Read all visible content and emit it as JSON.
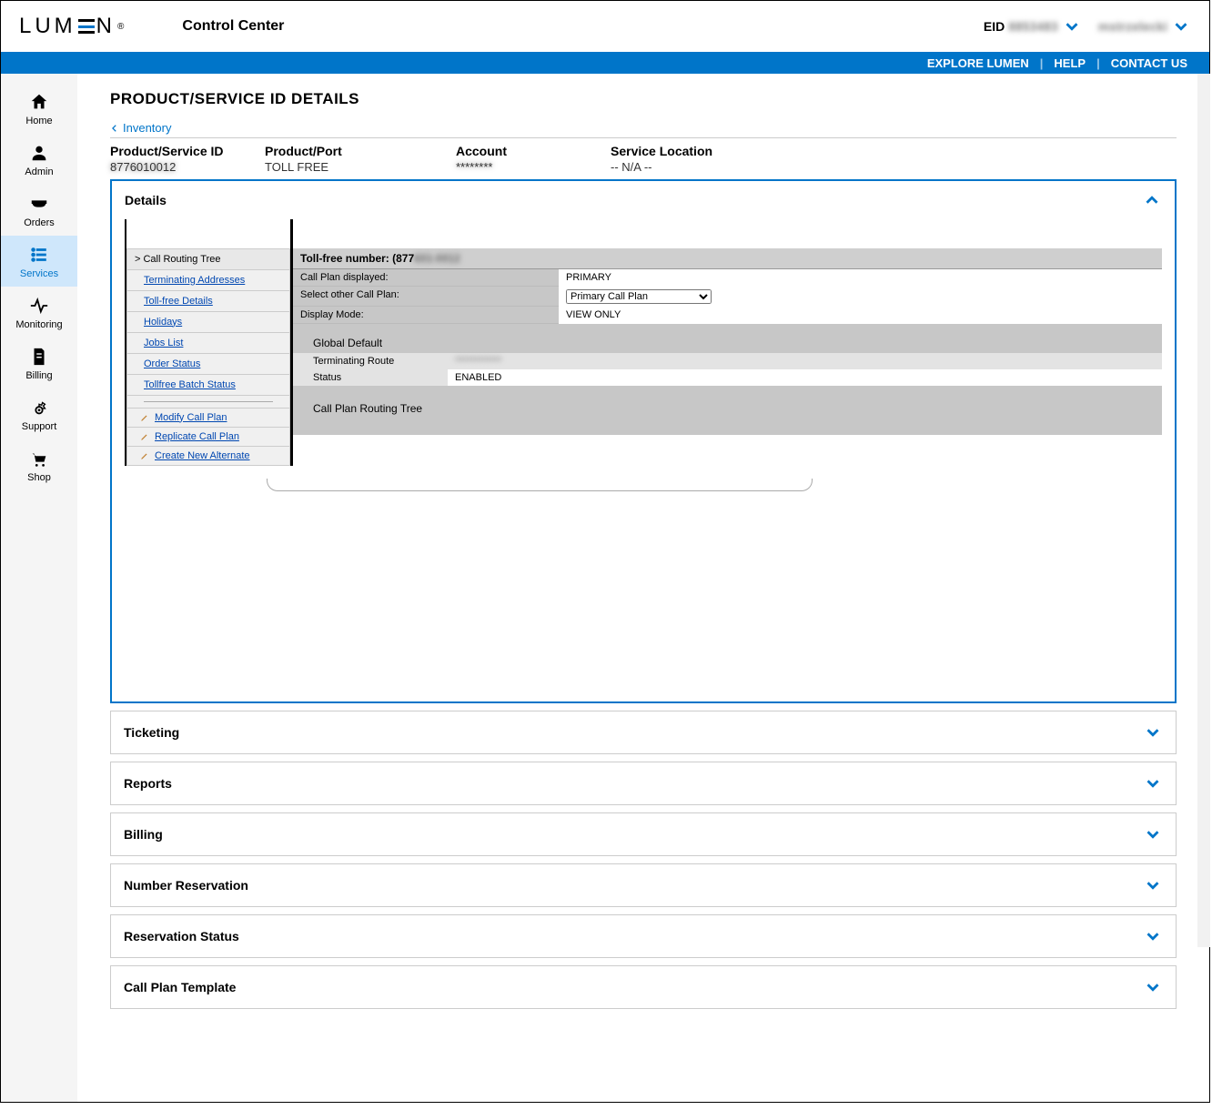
{
  "header": {
    "logo_text_left": "LUM",
    "logo_text_right": "N",
    "control_center": "Control Center",
    "eid_label": "EID",
    "eid_value": "8853483",
    "username": "mstrzelecki"
  },
  "bluebar": {
    "explore": "EXPLORE LUMEN",
    "help": "HELP",
    "contact": "CONTACT US"
  },
  "nav": [
    {
      "label": "Home",
      "icon": "home"
    },
    {
      "label": "Admin",
      "icon": "user"
    },
    {
      "label": "Orders",
      "icon": "tray"
    },
    {
      "label": "Services",
      "icon": "list"
    },
    {
      "label": "Monitoring",
      "icon": "activity"
    },
    {
      "label": "Billing",
      "icon": "invoice"
    },
    {
      "label": "Support",
      "icon": "gear"
    },
    {
      "label": "Shop",
      "icon": "cart"
    }
  ],
  "page": {
    "title": "PRODUCT/SERVICE ID DETAILS",
    "back": "Inventory"
  },
  "idrow": {
    "product_id_header": "Product/Service ID",
    "product_id_value": "8776010012",
    "product_port_header": "Product/Port",
    "product_port_value": "TOLL FREE",
    "account_header": "Account",
    "account_value": "********",
    "location_header": "Service Location",
    "location_value": "-- N/A --"
  },
  "details": {
    "title": "Details",
    "tree_header": "Call Routing Tree",
    "subnav": [
      "Terminating Addresses",
      "Toll-free Details",
      "Holidays",
      "Jobs List",
      "Order Status",
      "Tollfree Batch Status"
    ],
    "actions": [
      "Modify Call Plan",
      "Replicate Call Plan",
      "Create New Alternate"
    ],
    "tollfree_label": "Toll-free number: (877",
    "tollfree_value_suffix": "601-0012",
    "plan_displayed_k": "Call Plan displayed:",
    "plan_displayed_v": "PRIMARY",
    "select_plan_k": "Select other Call Plan:",
    "select_plan_option": "Primary Call Plan",
    "display_mode_k": "Display Mode:",
    "display_mode_v": "VIEW ONLY",
    "global_default": "Global Default",
    "term_route_k": "Terminating Route",
    "term_route_v": "************",
    "status_k": "Status",
    "status_v": "ENABLED",
    "routing_tree": "Call Plan Routing Tree"
  },
  "accordions": [
    "Ticketing",
    "Reports",
    "Billing",
    "Number Reservation",
    "Reservation Status",
    "Call Plan Template"
  ]
}
